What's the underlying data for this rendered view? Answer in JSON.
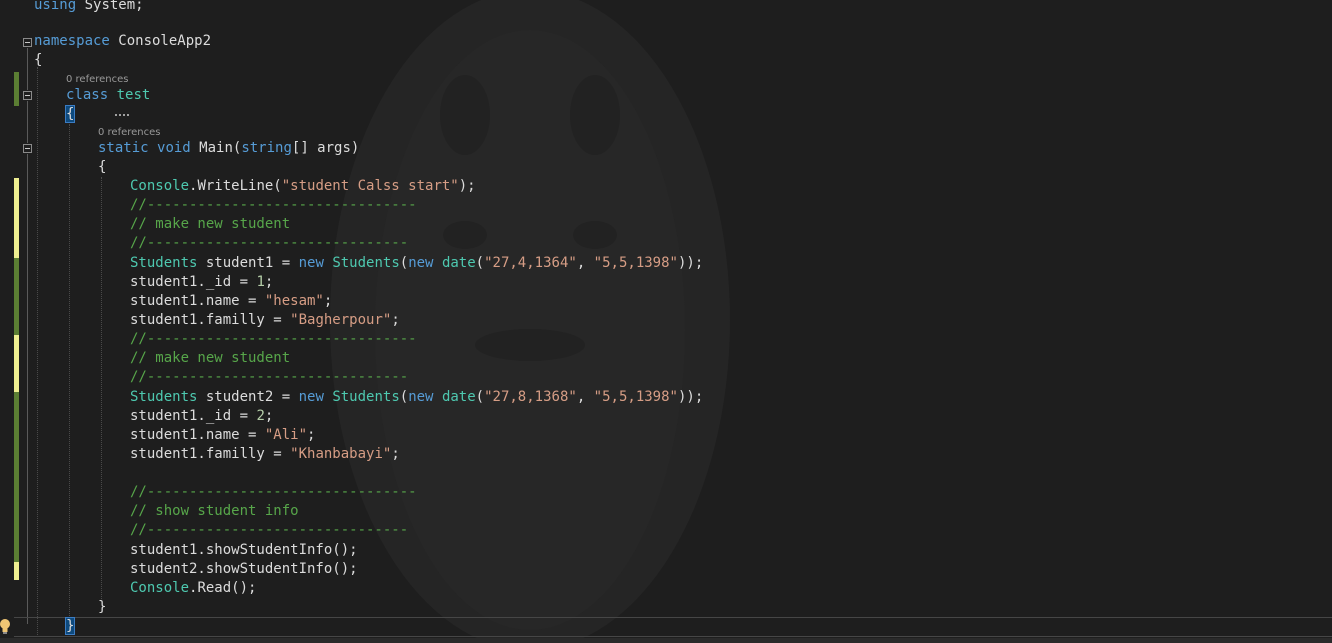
{
  "code": {
    "using_kw": "using",
    "using_rest": " System;",
    "ns_kw": "namespace",
    "ns_name": " ConsoleApp2",
    "brace_open": "{",
    "brace_close": "}",
    "class_kw": "class",
    "class_name": "test",
    "lens_class": "0 references",
    "lens_main": "0 references",
    "static_kw": "static",
    "void_kw": "void",
    "main_name": " Main(",
    "string_kw": "string",
    "args": "[] args)",
    "console": "Console",
    "writeline": ".WriteLine(",
    "writeline_str": "\"student Calss start\"",
    "close_semi": ");",
    "comment_sep_long": "//--------------------------------",
    "comment_sep_short": "//-------------------------------",
    "comment_make": "// make new student",
    "comment_show": "// show student info",
    "students_type": "Students",
    "s1_decl": " student1 = ",
    "s2_decl": " student2 = ",
    "new_kw": "new",
    "date_type": "date",
    "s1_date1": "\"27,4,1364\"",
    "s2_date1": "\"27,8,1368\"",
    "date2": "\"5,5,1398\"",
    "s1_id_prefix": "student1._id = ",
    "id_1": "1",
    "id_2": "2",
    "name_prefix": "student1.name = ",
    "name_hesam": "\"hesam\"",
    "name_ali": "\"Ali\"",
    "familly_prefix": "student1.familly = ",
    "familly_bagher": "\"Bagherpour\"",
    "familly_khan": "\"Khanbabayi\"",
    "semi": ";",
    "show1": "student1.showStudentInfo();",
    "show2": "student2.showStudentInfo();",
    "read_call": ".Read();"
  },
  "colors": {
    "keyword": "#569cd6",
    "type": "#4ec9b0",
    "string": "#d69d85",
    "comment": "#57a64a",
    "number": "#b5cea8",
    "plain": "#dcdcdc",
    "change_saved": "#5b7e33",
    "change_unsaved": "#efef91"
  }
}
